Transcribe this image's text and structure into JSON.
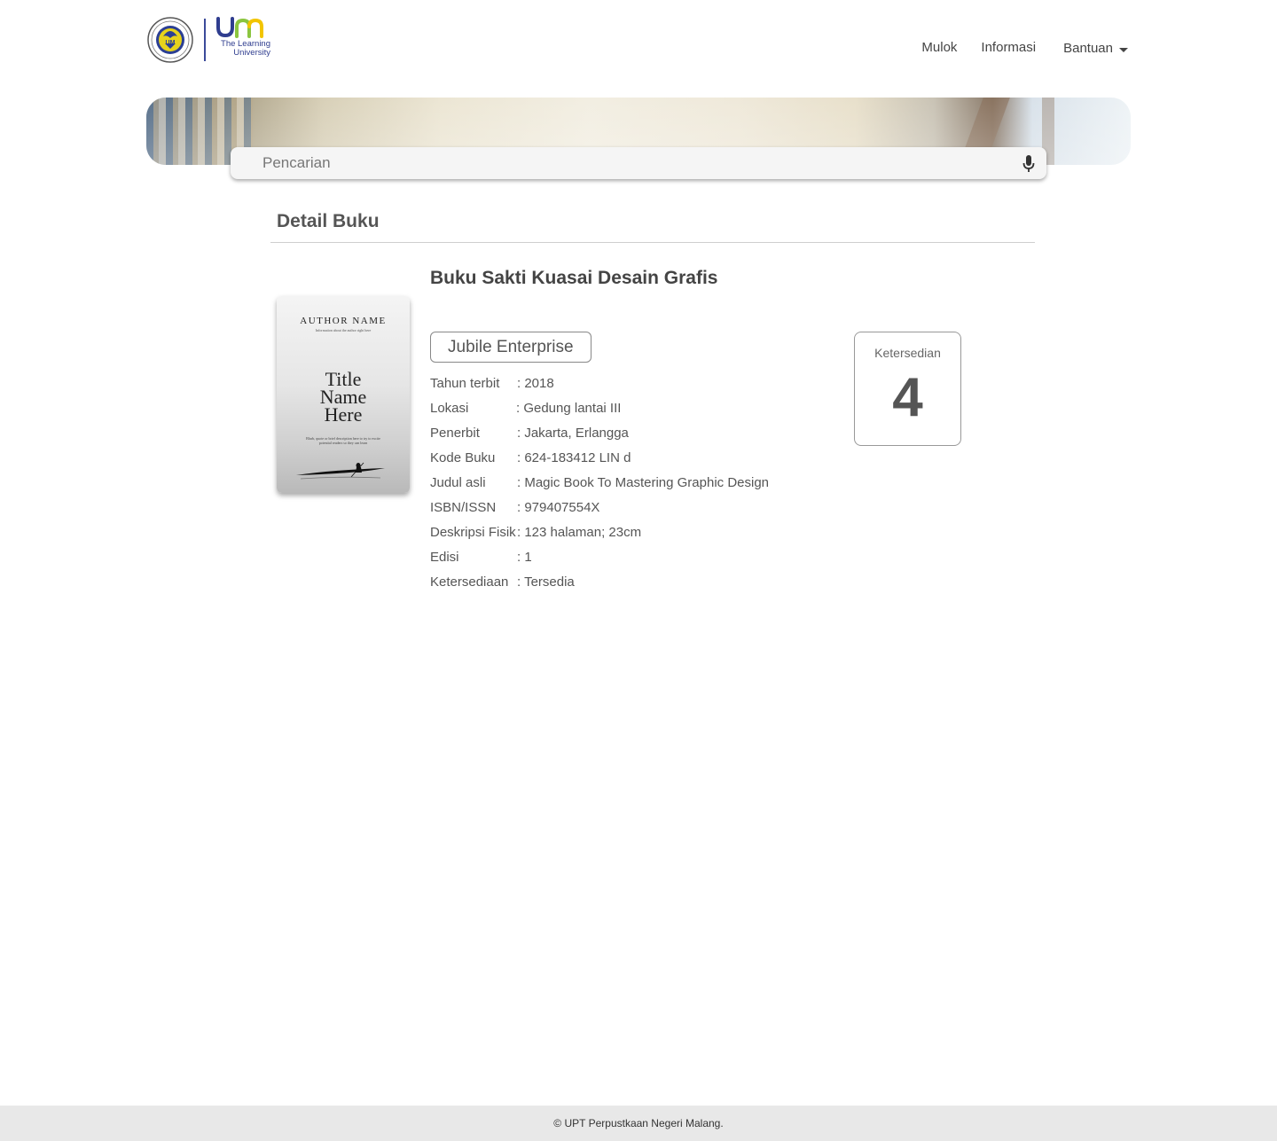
{
  "header": {
    "logo_tagline_line1": "The Learning",
    "logo_tagline_line2": "University",
    "nav": [
      {
        "label": "Mulok"
      },
      {
        "label": "Informasi"
      },
      {
        "label": "Bantuan"
      }
    ]
  },
  "search": {
    "placeholder": "Pencarian"
  },
  "detail": {
    "section_title": "Detail Buku",
    "cover": {
      "author": "AUTHOR NAME",
      "subtitle": "Information about the author right here",
      "title_line1": "Title",
      "title_line2": "Name",
      "title_line3": "Here",
      "blurb": "Blurb, quote or brief description here to try to excite potential readers so they can learn"
    },
    "book_title": "Buku Sakti Kuasai Desain Grafis",
    "publisher_tag": "Jubile Enterprise",
    "fields": [
      {
        "key": "Tahun terbit",
        "value": ": 2018"
      },
      {
        "key": "Lokasi",
        "value": ": Gedung lantai III"
      },
      {
        "key": "Penerbit",
        "value": ": Jakarta, Erlangga"
      },
      {
        "key": "Kode Buku",
        "value": ": 624-183412 LIN d"
      },
      {
        "key": "Judul asli",
        "value": ": Magic Book To Mastering Graphic Design"
      },
      {
        "key": "ISBN/ISSN",
        "value": ": 979407554X"
      },
      {
        "key": "Deskripsi Fisik",
        "value": ": 123 halaman; 23cm"
      },
      {
        "key": "Edisi",
        "value": ": 1"
      },
      {
        "key": "Ketersediaan",
        "value": ": Tersedia"
      }
    ],
    "availability": {
      "label": "Ketersedian",
      "count": "4"
    }
  },
  "footer": {
    "text": "© UPT Perpustkaan Negeri Malang."
  },
  "colors": {
    "brand_blue": "#2f3d8f",
    "brand_green": "#8bc53f",
    "brand_yellow": "#f2c500"
  }
}
